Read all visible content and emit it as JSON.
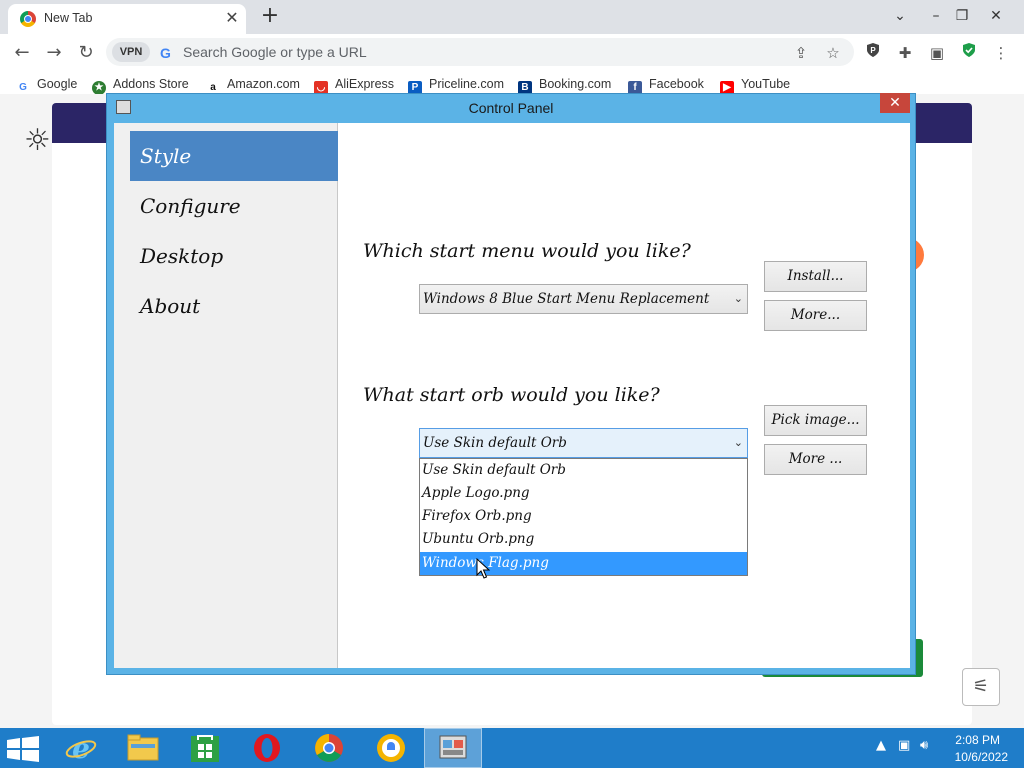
{
  "browser": {
    "tab_title": "New Tab",
    "tab_close": "✕",
    "new_tab": "+",
    "vpn_label": "VPN",
    "omnibox_placeholder": "Search Google or type a URL",
    "bookmarks": [
      {
        "label": "Google"
      },
      {
        "label": "Addons Store"
      },
      {
        "label": "Amazon.com"
      },
      {
        "label": "AliExpress"
      },
      {
        "label": "Priceline.com"
      },
      {
        "label": "Booking.com"
      },
      {
        "label": "Facebook"
      },
      {
        "label": "YouTube"
      }
    ]
  },
  "control_panel": {
    "title": "Control Panel",
    "close": "✕",
    "sidebar": [
      "Style",
      "Configure",
      "Desktop",
      "About"
    ],
    "q_start_menu": "Which start menu would you like?",
    "start_menu_value": "Windows 8 Blue Start Menu Replacement",
    "btn_install": "Install...",
    "btn_more_1": "More...",
    "q_start_orb": "What start orb would you like?",
    "orb_value": "Use Skin default Orb",
    "btn_pick_image": "Pick image...",
    "btn_more_2": "More ...",
    "orb_options": [
      "Use Skin default Orb",
      "Apple Logo.png",
      "Firefox Orb.png",
      "Ubuntu Orb.png",
      "Windows Flag.png"
    ],
    "highlighted_option": "Windows Flag.png"
  },
  "taskbar": {
    "time": "2:08 PM",
    "date": "10/6/2022"
  },
  "colors": {
    "window_frame": "#5bb3e6",
    "sidebar_selected": "#4a86c5",
    "list_highlight": "#3399ff",
    "taskbar": "#1f7dc9",
    "close_button": "#c7463b"
  }
}
